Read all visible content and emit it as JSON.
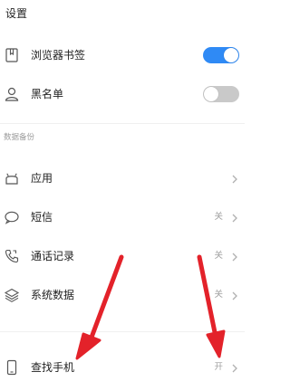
{
  "settings": {
    "section_title": "设置",
    "items": [
      {
        "label": "浏览器书签",
        "icon": "bookmark-icon",
        "toggle": "on"
      },
      {
        "label": "黑名单",
        "icon": "person-icon",
        "toggle": "off"
      }
    ]
  },
  "backup": {
    "section_title": "数据备份",
    "items": [
      {
        "label": "应用",
        "icon": "android-icon"
      },
      {
        "label": "短信",
        "icon": "chat-bubble-icon",
        "value": "关"
      },
      {
        "label": "通话记录",
        "icon": "phone-icon",
        "value": "关"
      },
      {
        "label": "系统数据",
        "icon": "layers-icon",
        "value": "关"
      }
    ]
  },
  "find_phone": {
    "label": "查找手机",
    "icon": "phone-device-icon",
    "value": "开"
  },
  "colors": {
    "toggle_on": "#2f8af5",
    "toggle_off": "#c9c9c9",
    "annotation_arrow": "#e3222a"
  }
}
